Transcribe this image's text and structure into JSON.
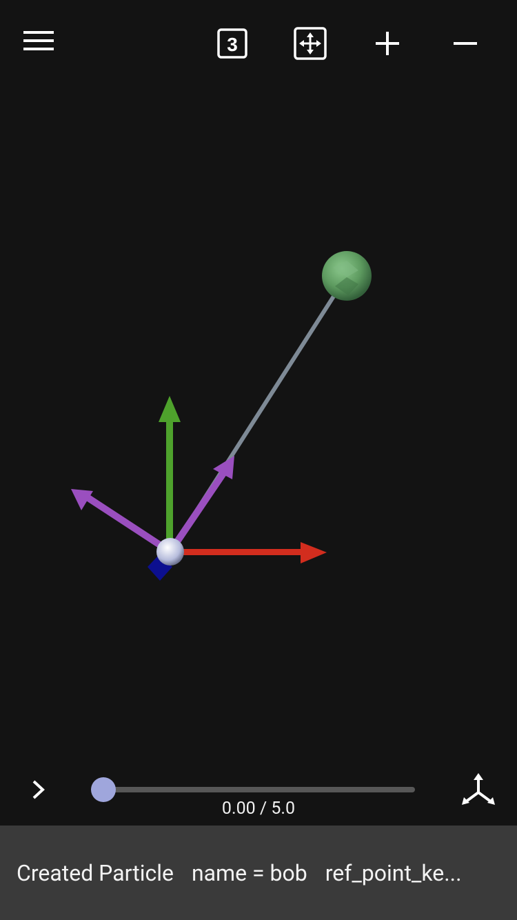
{
  "toolbar": {
    "menu_icon": "hamburger-menu-icon",
    "view3d_icon": "view-3d-icon",
    "view3d_text": "3",
    "fit_icon": "fit-view-icon",
    "zoom_in_icon": "plus-icon",
    "zoom_out_icon": "minus-icon"
  },
  "playback": {
    "play_icon": "chevron-right-icon",
    "time_label": "0.00 / 5.0",
    "current_time": 0.0,
    "end_time": 5.0,
    "axes_icon": "axes-toggle-icon"
  },
  "console": {
    "messages": [
      "Created Particle",
      "name = bob",
      "ref_point_ke..."
    ]
  },
  "colors": {
    "background": "#131313",
    "rod": "#7e8a96",
    "bob": "#5d9a5f",
    "x_axis": "#d22d1e",
    "y_axis": "#4ea22c",
    "vector": "#9a4fbf",
    "pivot": "#c7cbe3",
    "pivot_marker": "#0c0f8f",
    "slider_thumb": "#9fa6dc",
    "console_bg": "#3a3a3a"
  }
}
